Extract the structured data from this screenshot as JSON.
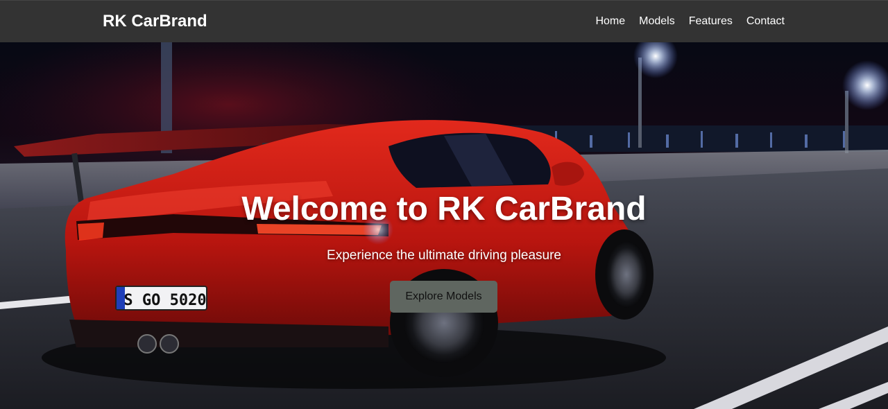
{
  "navbar": {
    "brand": "RK CarBrand",
    "links": [
      {
        "label": "Home"
      },
      {
        "label": "Models"
      },
      {
        "label": "Features"
      },
      {
        "label": "Contact"
      }
    ]
  },
  "hero": {
    "title": "Welcome to RK CarBrand",
    "subtitle": "Experience the ultimate driving pleasure",
    "cta_label": "Explore Models",
    "license_plate": "S GO 5020"
  },
  "colors": {
    "navbar_bg": "#333333",
    "text": "#ffffff",
    "button_bg": "#5f6660",
    "car_red": "#c21a12"
  }
}
